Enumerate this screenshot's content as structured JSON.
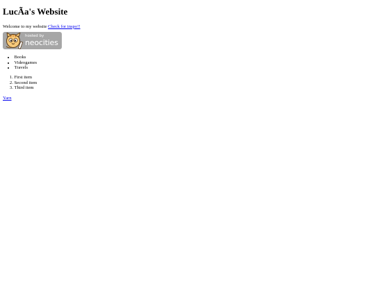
{
  "title": "LucÃ­a's Website",
  "welcome": {
    "text": "Welcome to my website",
    "link_label": "Check for inspo!!"
  },
  "badge": {
    "hosted_text": "hosted by",
    "brand_text": "neocities",
    "background_color": "#a6a6a6",
    "icon": "neocities-cat-icon"
  },
  "unordered_list": [
    "Books",
    "Videogames",
    "Travels"
  ],
  "ordered_list": [
    "First item",
    "Second item",
    "Third item"
  ],
  "footer_link": "Yarn",
  "link_color": "#0000ee"
}
